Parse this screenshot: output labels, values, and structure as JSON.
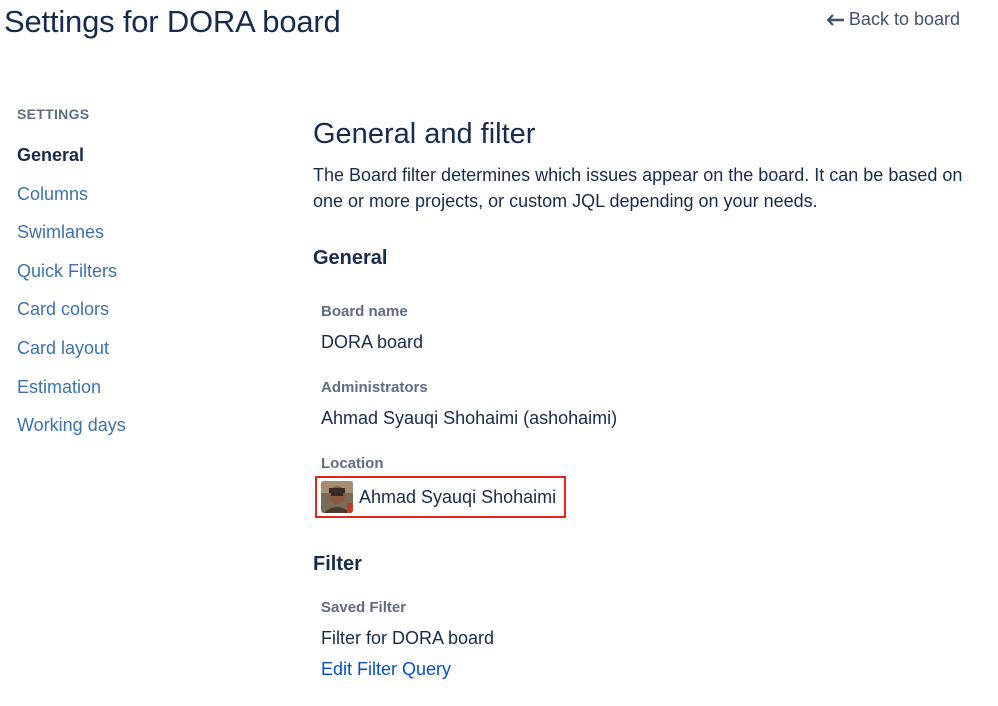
{
  "header": {
    "title": "Settings for DORA board",
    "back_label": "Back to board"
  },
  "sidebar": {
    "heading": "SETTINGS",
    "items": [
      {
        "label": "General",
        "active": true
      },
      {
        "label": "Columns",
        "active": false
      },
      {
        "label": "Swimlanes",
        "active": false
      },
      {
        "label": "Quick Filters",
        "active": false
      },
      {
        "label": "Card colors",
        "active": false
      },
      {
        "label": "Card layout",
        "active": false
      },
      {
        "label": "Estimation",
        "active": false
      },
      {
        "label": "Working days",
        "active": false
      }
    ]
  },
  "main": {
    "title": "General and filter",
    "intro": "The Board filter determines which issues appear on the board. It can be based on one or more projects, or custom JQL depending on your needs.",
    "general": {
      "heading": "General",
      "board_name_label": "Board name",
      "board_name_value": "DORA board",
      "administrators_label": "Administrators",
      "administrators_value": "Ahmad Syauqi Shohaimi (ashohaimi)",
      "location_label": "Location",
      "location_value": "Ahmad Syauqi Shohaimi"
    },
    "filter": {
      "heading": "Filter",
      "saved_filter_label": "Saved Filter",
      "saved_filter_value": "Filter for DORA board",
      "edit_link_label": "Edit Filter Query"
    }
  },
  "colors": {
    "highlight_border": "#e2261a",
    "link": "#3b73af",
    "primary_link": "#0052cc",
    "text": "#172b4d",
    "muted": "#5e6c84"
  },
  "icons": {
    "back": "arrow-left-icon",
    "location_avatar": "user-avatar"
  }
}
